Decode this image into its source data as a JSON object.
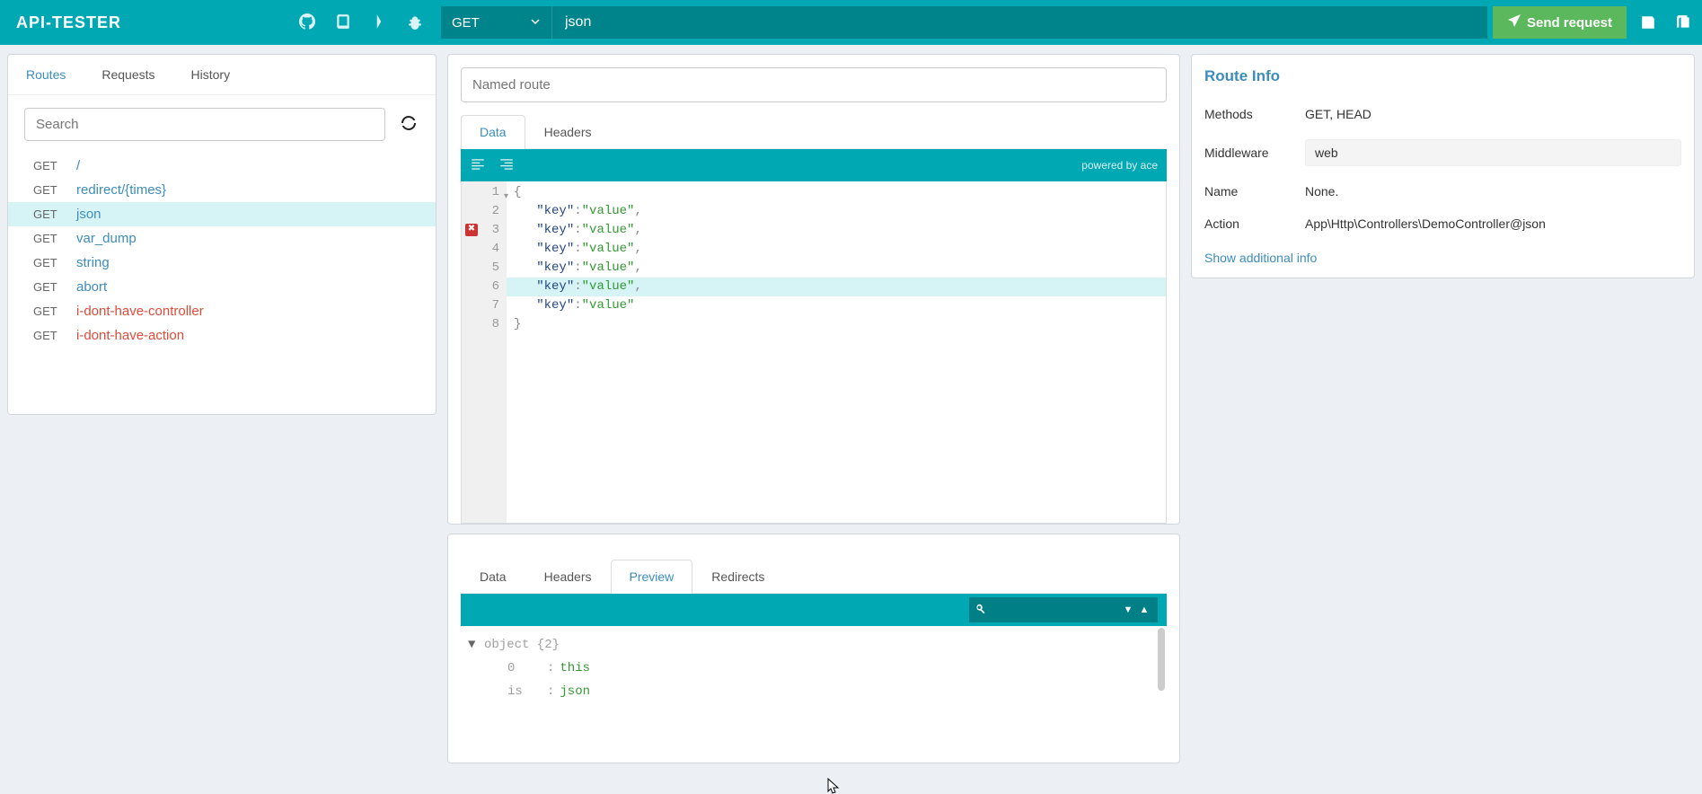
{
  "app": {
    "title": "API-TESTER"
  },
  "topbar": {
    "method": "GET",
    "url": "json",
    "send_label": "Send request"
  },
  "sidebar": {
    "tabs": [
      "Routes",
      "Requests",
      "History"
    ],
    "active_tab": 0,
    "search_placeholder": "Search",
    "routes": [
      {
        "method": "GET",
        "path": "/",
        "state": "blue"
      },
      {
        "method": "GET",
        "path": "redirect/{times}",
        "state": "blue"
      },
      {
        "method": "GET",
        "path": "json",
        "state": "blue",
        "active": true
      },
      {
        "method": "GET",
        "path": "var_dump",
        "state": "blue"
      },
      {
        "method": "GET",
        "path": "string",
        "state": "blue"
      },
      {
        "method": "GET",
        "path": "abort",
        "state": "blue"
      },
      {
        "method": "GET",
        "path": "i-dont-have-controller",
        "state": "red"
      },
      {
        "method": "GET",
        "path": "i-dont-have-action",
        "state": "red"
      }
    ]
  },
  "editor": {
    "named_placeholder": "Named route",
    "tabs": [
      "Data",
      "Headers"
    ],
    "active_tab": 0,
    "powered": "powered by ace",
    "lines": [
      {
        "n": 1,
        "text": "{",
        "fold": true
      },
      {
        "n": 2,
        "text": "   \"key\":\"value\","
      },
      {
        "n": 3,
        "text": "   \"key\":\"value\",",
        "error": true
      },
      {
        "n": 4,
        "text": "   \"key\":\"value\","
      },
      {
        "n": 5,
        "text": "   \"key\":\"value\","
      },
      {
        "n": 6,
        "text": "   \"key\":\"value\",",
        "current": true
      },
      {
        "n": 7,
        "text": "   \"key\":\"value\""
      },
      {
        "n": 8,
        "text": "}"
      }
    ]
  },
  "result": {
    "tabs": [
      "Data",
      "Headers",
      "Preview",
      "Redirects"
    ],
    "active_tab": 2,
    "tree": {
      "root_label": "object {2}",
      "rows": [
        {
          "key": "0",
          "val": "this"
        },
        {
          "key": "is",
          "val": "json"
        }
      ]
    }
  },
  "info": {
    "title": "Route Info",
    "rows": [
      {
        "label": "Methods",
        "value": "GET, HEAD",
        "boxed": false
      },
      {
        "label": "Middleware",
        "value": "web",
        "boxed": true
      },
      {
        "label": "Name",
        "value": "None.",
        "boxed": false
      },
      {
        "label": "Action",
        "value": "App\\Http\\Controllers\\DemoController@json",
        "boxed": false
      }
    ],
    "link": "Show additional info"
  }
}
